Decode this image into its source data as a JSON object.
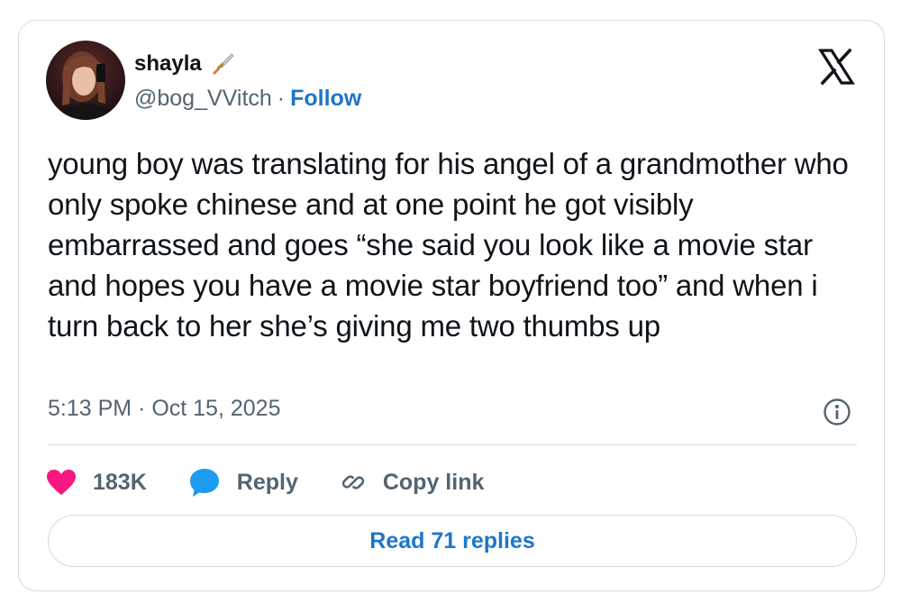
{
  "author": {
    "display_name": "shayla",
    "handle": "@bog_VVitch",
    "separator": "·",
    "follow_label": "Follow",
    "name_emoji_icon": "dagger-icon"
  },
  "tweet": {
    "text": "young boy was translating for his angel of a grandmother who only spoke chinese and at one point he got visibly embarrassed and goes “she said you look like a movie star and hopes you have a movie star boyfriend too” and when i turn back to her she’s giving me two thumbs up",
    "timestamp": "5:13 PM · Oct 15, 2025"
  },
  "actions": {
    "like_count": "183K",
    "reply_label": "Reply",
    "copy_link_label": "Copy link"
  },
  "read_replies_label": "Read 71 replies",
  "colors": {
    "like": "#f91880",
    "reply": "#1d9bf0",
    "link": "#1d76c8",
    "muted": "#536471",
    "border": "#d6d9db"
  }
}
